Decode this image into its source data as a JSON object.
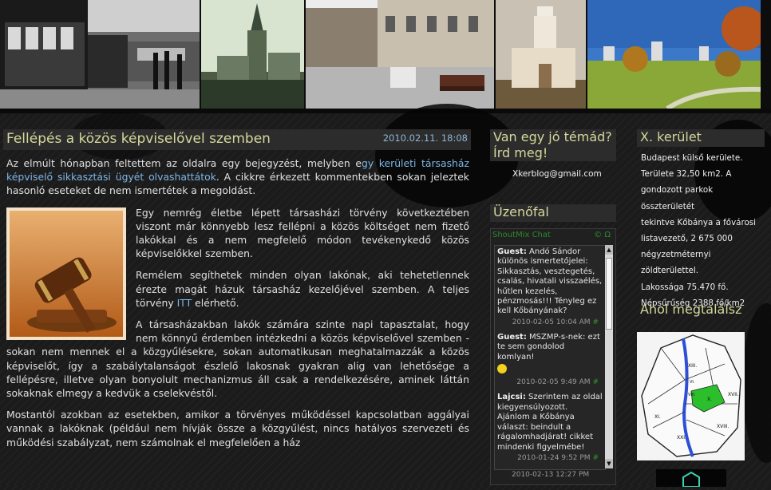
{
  "post": {
    "title": "Fellépés a közös képviselővel szemben",
    "date": "2010.02.11. 18:08",
    "p1_a": "Az elmúlt hónapban feltettem az oldalra egy bejegyzést, melyben e",
    "p1_link": "gy kerületi társasház képviselő sikkasztási ügyét olvashattátok",
    "p1_b": ". A cikkre érkezett kommentekben sokan jeleztek hasonló eseteket  de nem ismertétek a megoldást.",
    "p2": "Egy nemrég életbe lépett társasházi törvény következtében viszont már könnyebb lesz fellépni a közös költséget nem fizető lakókkal és a nem megfelelő módon tevékenykedő közös képviselőkkel szemben.",
    "p3_a": "Remélem segíthetek minden olyan lakónak, aki tehetetlennek érezte magát házuk társasház kezelőjével szemben. A teljes törvény ",
    "p3_link": "ITT",
    "p3_b": " elérhető.",
    "p4": "A társasházakban lakók számára szinte napi tapasztalat, hogy nem könnyű érdemben intézkedni a közös képviselővel szemben - sokan nem mennek el a közgyűlésekre, sokan automatikusan meghatalmazzák a közös képviselőt, így a szabálytalanságot észlelő lakosnak gyakran alig van lehetősége a fellépésre, illetve olyan bonyolult mechanizmus áll csak a rendelkezésére, aminek láttán sokaknak elmegy a kedvük a cselekvéstől.",
    "p5": "Mostantól azokban az esetekben, amikor a törvényes működéssel kapcsolatban aggályai vannak a lakóknak (például nem hívják össze a közgyűlést, nincs hatályos szervezeti és működési szabályzat, nem számolnak el megfelelően a ház"
  },
  "sidebar": {
    "topic_heading_1": "Van egy jó témád?",
    "topic_heading_2": "Írd meg!",
    "email": "Xkerblog@gmail.com",
    "wall_heading": "Üzenőfal",
    "shoutmix_label": "ShoutMix Chat",
    "shoutmix_icons": "© Ω",
    "messages": [
      {
        "author": "Guest:",
        "text": " Andó Sándor különös ismertetőjelei: Sikkasztás, vesztegetés, csalás, hivatali visszaélés, hűtlen kezelés, pénzmosás!!! Tényleg ez kell Kőbányának?",
        "time": "2010-02-05 10:04 AM"
      },
      {
        "author": "Guest:",
        "text": " MSZMP-s-nek: ezt te sem gondolod komlyan!",
        "time": "2010-02-05 9:49 AM"
      },
      {
        "author": "Lajcsi:",
        "text": " Szerintem az oldal kiegyensúlyozott. Ajánlom a Kőbánya választ: beindult a rágalomhadjárat! cikket mindenki figyelmébe!",
        "time": "2010-01-24 9:52 PM"
      }
    ],
    "footer_time": "2010-02-13 12:27 PM"
  },
  "district": {
    "heading": "X. kerület",
    "lines": [
      "Budapest külső kerülete.",
      "Területe 32,50 km2. A",
      "gondozott parkok összterületét",
      "tekintve Kőbánya a fővárosi",
      "listavezető, 2 675 000",
      "négyzetméternyi zöldterülettel.",
      "Lakossága 75.470 fő.",
      "Népsűrűség 2388 fő/km2"
    ],
    "map_heading": "Ahol megtalálsz",
    "map_labels": [
      "X.",
      "XVII.",
      "XVIII.",
      "XI.",
      "XXI.",
      "VIII.",
      "XIII.",
      "VI."
    ]
  },
  "colors": {
    "heading": "#d4d89a",
    "link": "#7fb6e6",
    "date": "#8fb4d8",
    "highlight_district": "#2bbf2b"
  }
}
